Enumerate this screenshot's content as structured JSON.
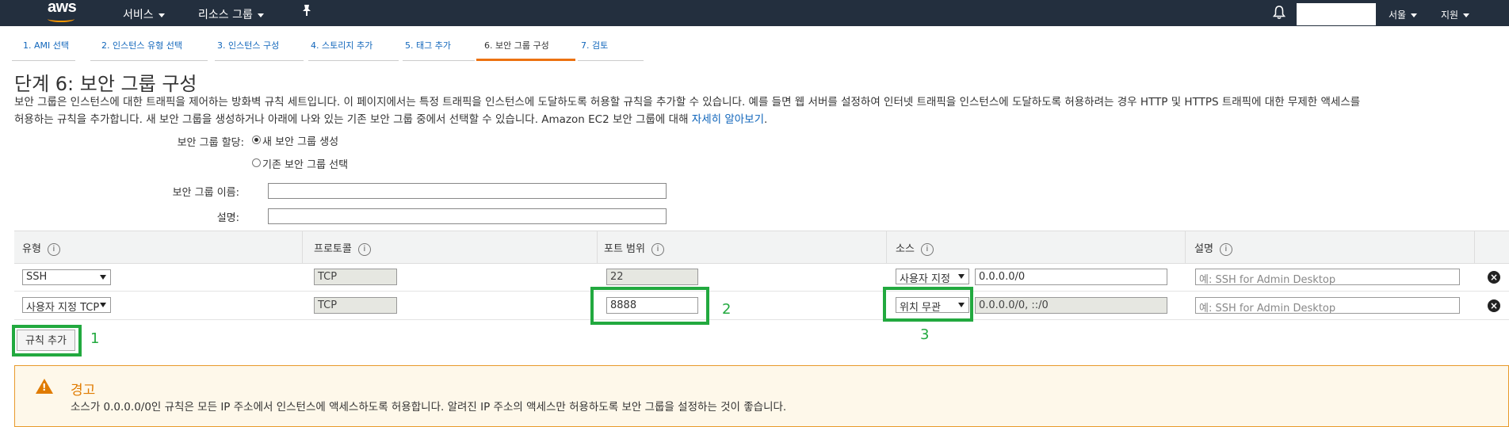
{
  "header": {
    "logo": "aws",
    "services": "서비스",
    "resource_groups": "리소스 그룹",
    "pin_icon": "pin-icon",
    "bell_icon": "bell-icon",
    "region": "서울",
    "support": "지원",
    "bg_color": "#232f3e"
  },
  "steps": [
    {
      "label": "1. AMI 선택"
    },
    {
      "label": "2. 인스턴스 유형 선택"
    },
    {
      "label": "3. 인스턴스 구성"
    },
    {
      "label": "4. 스토리지 추가"
    },
    {
      "label": "5. 태그 추가"
    },
    {
      "label": "6. 보안 그룹 구성",
      "active": true
    },
    {
      "label": "7. 검토"
    }
  ],
  "page": {
    "title": "단계 6: 보안 그룹 구성",
    "desc_line1": "보안 그룹은 인스턴스에 대한 트래픽을 제어하는 방화벽 규칙 세트입니다. 이 페이지에서는 특정 트래픽을 인스턴스에 도달하도록 허용할 규칙을 추가할 수 있습니다. 예를 들면 웹 서버를 설정하여 인터넷 트래픽을 인스턴스에 도달하도록 허용하려는 경우 HTTP 및 HTTPS 트래픽에 대한 무제한 액세스를",
    "desc_line2": "허용하는 규칙을 추가합니다. 새 보안 그룹을 생성하거나 아래에 나와 있는 기존 보안 그룹 중에서 선택할 수 있습니다. Amazon EC2 보안 그룹에 대해",
    "learn_more": "자세히 알아보기",
    "desc_end": "."
  },
  "form": {
    "assign_label": "보안 그룹 할당:",
    "radio_new": "새 보안 그룹 생성",
    "radio_existing": "기존 보안 그룹 선택",
    "name_label": "보안 그룹 이름:",
    "desc_label": "설명:",
    "name_value": "",
    "desc_value": ""
  },
  "table": {
    "headers": [
      "유형",
      "프로토콜",
      "포트 범위",
      "소스",
      "설명"
    ],
    "info_glyph": "i",
    "rows": [
      {
        "type": "SSH",
        "protocol": "TCP",
        "port": "22",
        "source_select": "사용자 지정",
        "source_value": "0.0.0.0/0",
        "desc_placeholder": "예: SSH for Admin Desktop"
      },
      {
        "type": "사용자 지정 TCP",
        "protocol": "TCP",
        "port": "8888",
        "source_select": "위치 무관",
        "source_value": "0.0.0.0/0, ::/0",
        "desc_placeholder": "예: SSH for Admin Desktop"
      }
    ],
    "remove_glyph": "×"
  },
  "add_rule_label": "규칙 추가",
  "annotations": {
    "n1": "1",
    "n2": "2",
    "n3": "3",
    "color": "#22a93f"
  },
  "warning": {
    "title": "경고",
    "text": "소스가 0.0.0.0/0인 규칙은 모든 IP 주소에서 인스턴스에 액세스하도록 허용합니다. 알려진 IP 주소의 액세스만 허용하도록 보안 그룹을 설정하는 것이 좋습니다.",
    "icon": "warning-icon",
    "glyph": "!"
  }
}
